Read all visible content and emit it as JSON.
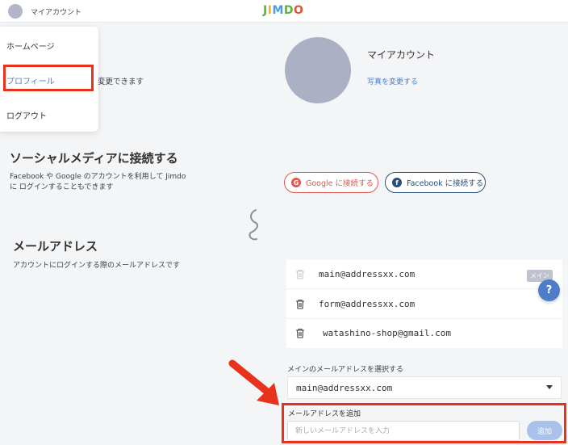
{
  "header": {
    "account_label": "マイアカウント",
    "logo": {
      "letters": [
        "J",
        "I",
        "M",
        "D",
        "O"
      ],
      "colors": [
        "#5db33a",
        "#f2b31c",
        "#4a9be0",
        "#5db33a",
        "#e84e3c"
      ]
    }
  },
  "menu": {
    "items": [
      {
        "label": "ホームページ"
      },
      {
        "label": "プロフィール",
        "active": true
      },
      {
        "label": "ログアウト"
      }
    ]
  },
  "profile": {
    "partial_text": "変更できます",
    "title": "マイアカウント",
    "change_photo": "写真を変更する"
  },
  "social": {
    "heading": "ソーシャルメディアに接続する",
    "description": "Facebook や Google のアカウントを利用して Jimdo に ログインすることもできます",
    "google_button": "Google に接続する",
    "google_icon": "G",
    "facebook_button": "Facebook に接続する",
    "facebook_icon": "f"
  },
  "email": {
    "heading": "メールアドレス",
    "description": "アカウントにログインする際のメールアドレスです",
    "addresses": [
      {
        "address": "main@addressxx.com",
        "badge": "メイン"
      },
      {
        "address": "form@addressxx.com"
      },
      {
        "address": "watashino-shop@gmail.com"
      }
    ],
    "select_label": "メインのメールアドレスを選択する",
    "selected": "main@addressxx.com",
    "add_label": "メールアドレスを追加",
    "add_placeholder": "新しいメールアドレスを入力",
    "add_button": "追加"
  },
  "help": {
    "label": "?"
  },
  "colors": {
    "accent": "#4a7ecb",
    "highlight": "#e8321b",
    "google": "#e0574d",
    "facebook": "#2b4f7d"
  }
}
